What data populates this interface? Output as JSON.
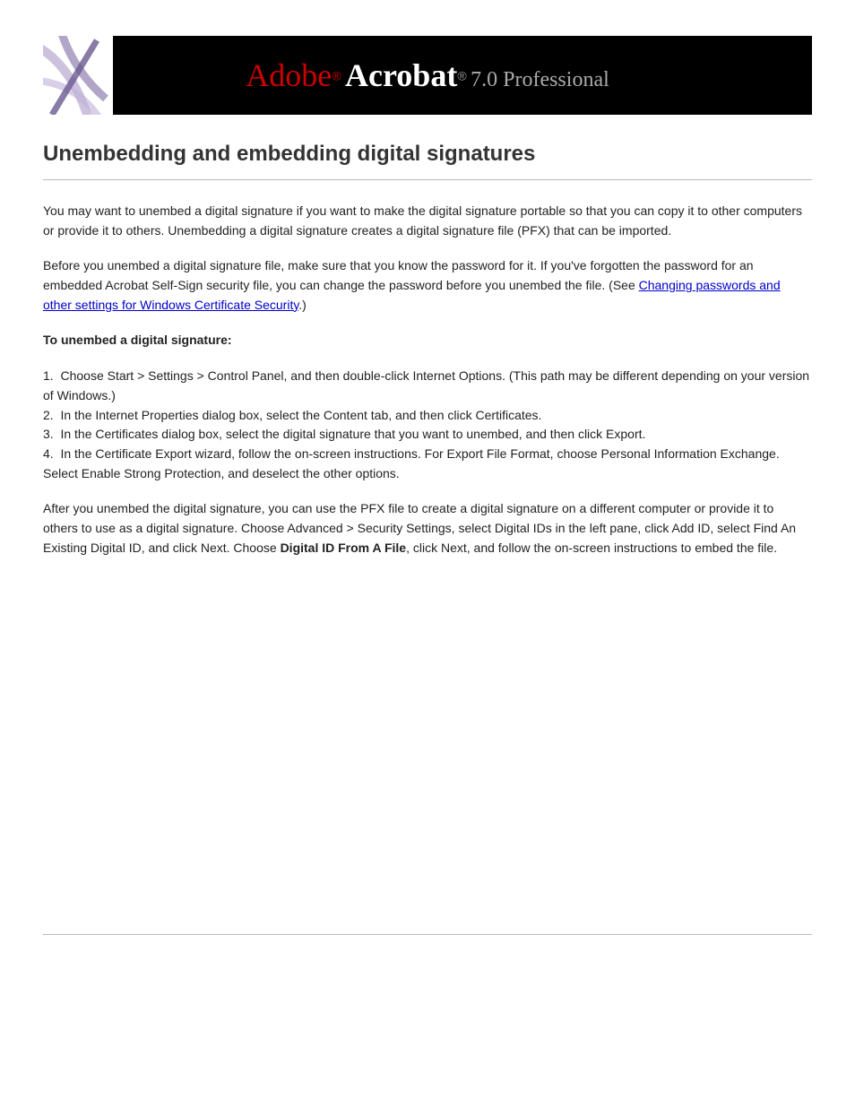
{
  "header": {
    "brand_prefix": "Adobe",
    "product": "Acrobat",
    "version_suffix": "7.0 Professional"
  },
  "title": "Unembedding and embedding digital signatures",
  "paragraphs": {
    "p1": "You may want to unembed a digital signature if you want to make the digital signature portable so that you can copy it to other computers or provide it to others. Unembedding a digital signature creates a digital signature file (PFX) that can be imported.",
    "p2_prefix": "Before you unembed a digital signature file, make sure that you know the password for it. If you've forgotten the password for an embedded Acrobat Self-Sign security file, you can change the password before you unembed the file. (See ",
    "p2_link": "Changing passwords and other settings for Windows Certificate Security",
    "p2_suffix": ".)",
    "p3_label": "To unembed a digital signature:",
    "p4_part1": "Choose Start > Settings > Control Panel, and then double-click Internet Options. (This path may be different depending on your version of Windows.)",
    "p4_part2a": "In the Internet Properties dialog box, select the Content tab, and then click Certificates.",
    "p4_part2b": "In the Certificates dialog box, select the digital signature that you want to unembed, and then click Export.",
    "p4_part2c": "In the Certificate Export wizard, follow the on-screen instructions. For Export File Format, choose Personal Information Exchange. Select Enable Strong Protection, and deselect the other options.",
    "p5_prefix": "After you unembed the digital signature, you can use the PFX file to create a digital signature on a different computer or provide it to others to use as a digital signature. Choose Advanced > Security Settings, select Digital IDs in the left pane, click Add ID, select Find An Existing Digital ID, and click Next. Choose ",
    "p5_bold": "Digital ID From A File",
    "p5_suffix": ", click Next, and follow the on-screen instructions to embed the file."
  }
}
